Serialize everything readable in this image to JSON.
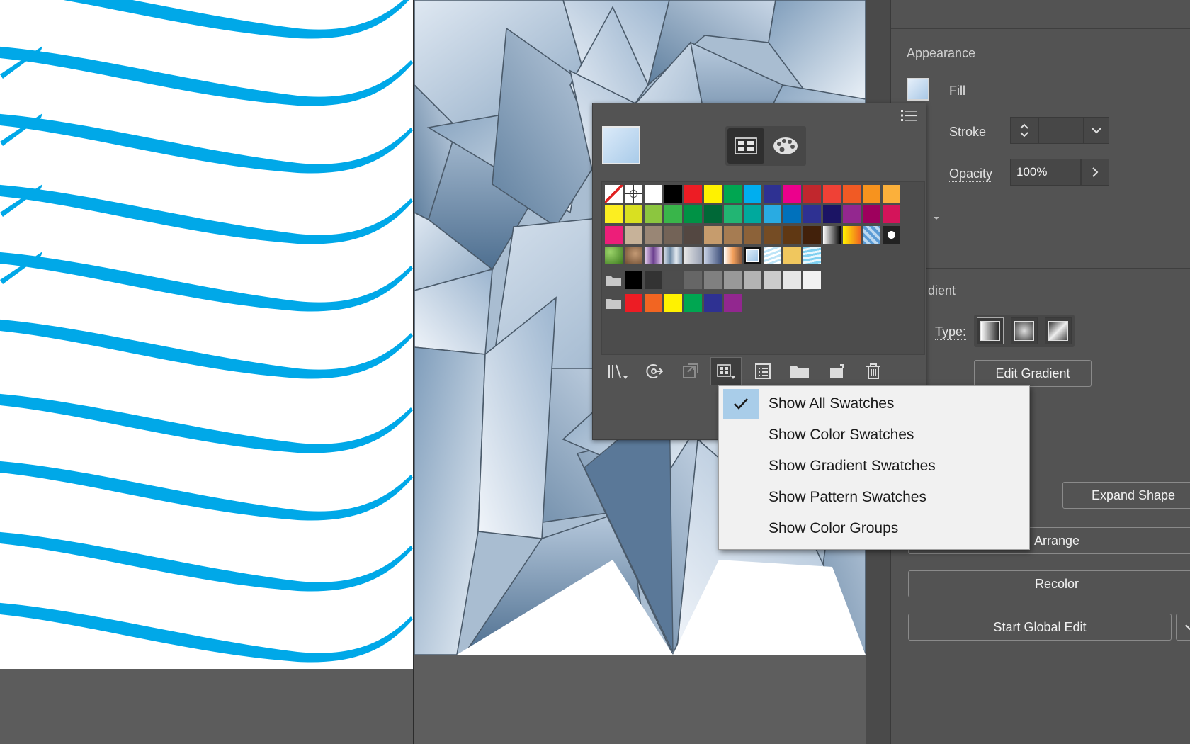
{
  "appearance": {
    "title": "Appearance",
    "fill_label": "Fill",
    "stroke_label": "Stroke",
    "opacity_label": "Opacity",
    "opacity_value": "100%"
  },
  "gradient": {
    "title": "dient",
    "type_label": "Type:",
    "edit_button": "Edit Gradient"
  },
  "quick_actions": {
    "expand_shape": "Expand Shape",
    "arrange": "Arrange",
    "recolor": "Recolor",
    "start_global_edit": "Start Global Edit"
  },
  "swatches_toolbar_icons": [
    "swatch-libraries-icon",
    "add-to-library-icon",
    "place-swatches-icon",
    "show-kinds-menu-icon",
    "swatch-options-icon",
    "new-color-group-icon",
    "new-swatch-icon",
    "delete-swatch-icon"
  ],
  "show_kinds_menu": {
    "items": [
      {
        "label": "Show All Swatches",
        "checked": true
      },
      {
        "label": "Show Color Swatches",
        "checked": false
      },
      {
        "label": "Show Gradient Swatches",
        "checked": false
      },
      {
        "label": "Show Pattern Swatches",
        "checked": false
      },
      {
        "label": "Show Color Groups",
        "checked": false
      }
    ]
  },
  "swatch_rows": [
    [
      "none",
      "registration",
      "#ffffff",
      "#000000",
      "#ed1c24",
      "#fff200",
      "#00a651",
      "#00aeef",
      "#2e3192",
      "#ec008c",
      "#c1272d",
      "#ef4136",
      "#f15a24",
      "#f7931e",
      "#fbb03b"
    ],
    [
      "#fcee21",
      "#d9e021",
      "#8cc63f",
      "#39b54a",
      "#009245",
      "#006837",
      "#22b573",
      "#00a99d",
      "#29abe2",
      "#0071bc",
      "#2e3192",
      "#1b1464",
      "#93278f",
      "#9e005d",
      "#d4145a"
    ],
    [
      "#ed1e79",
      "#c7b299",
      "#998675",
      "#736357",
      "#534741",
      "#c69c6d",
      "#a67c52",
      "#8c6239",
      "#754c24",
      "#603813",
      "#42210b",
      "gradient:gray",
      "gradient:orange",
      "pattern:blue",
      "pattern:dots"
    ],
    [
      "pattern:leaf",
      "pattern:stone",
      "gradient:purple",
      "gradient:steel",
      "gradient:silver",
      "gradient:navy",
      "gradient:peach",
      "selected:lightblue",
      "pattern:wave",
      "#f0c75e",
      "pattern:water"
    ]
  ],
  "gray_group": [
    "#000000",
    "#333333",
    "#4d4d4d",
    "#666666",
    "#808080",
    "#999999",
    "#b3b3b3",
    "#cccccc",
    "#e6e6e6",
    "#f2f2f2"
  ],
  "color_group": [
    "#ed1c24",
    "#f26522",
    "#fff200",
    "#00a651",
    "#2e3192",
    "#92278f"
  ],
  "colors": {
    "stroke_blue": "#00a8e8",
    "panel_bg": "#535353",
    "menu_bg": "#f1f1f1",
    "check_highlight": "#a9cde9"
  }
}
